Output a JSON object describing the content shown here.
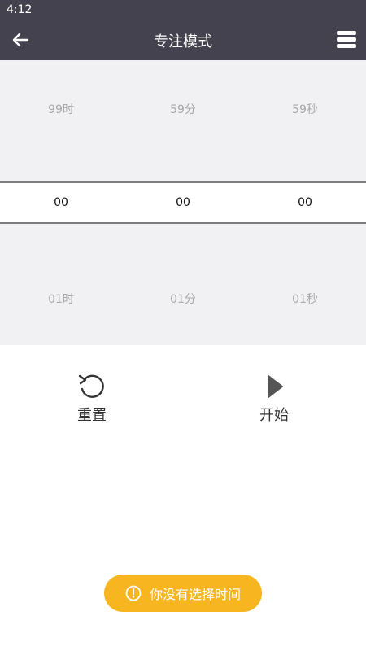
{
  "status_bar": {
    "time": "4:12"
  },
  "app_bar": {
    "title": "专注模式",
    "back_icon": "arrow-left-icon",
    "menu_icon": "hamburger-menu-icon"
  },
  "picker": {
    "columns": [
      {
        "unit": "hours",
        "prev": "99时",
        "current": "00",
        "next": "01时"
      },
      {
        "unit": "minutes",
        "prev": "59分",
        "current": "00",
        "next": "01分"
      },
      {
        "unit": "seconds",
        "prev": "59秒",
        "current": "00",
        "next": "01秒"
      }
    ]
  },
  "actions": {
    "reset": {
      "label": "重置",
      "icon": "reset-icon"
    },
    "start": {
      "label": "开始",
      "icon": "play-icon"
    }
  },
  "toast": {
    "text": "你没有选择时间",
    "icon": "exclamation-icon",
    "color": "#f7b520"
  },
  "colors": {
    "app_bar": "#44424f",
    "picker_bg": "#f1f1f3",
    "picker_dim_text": "#a7a7ab"
  }
}
